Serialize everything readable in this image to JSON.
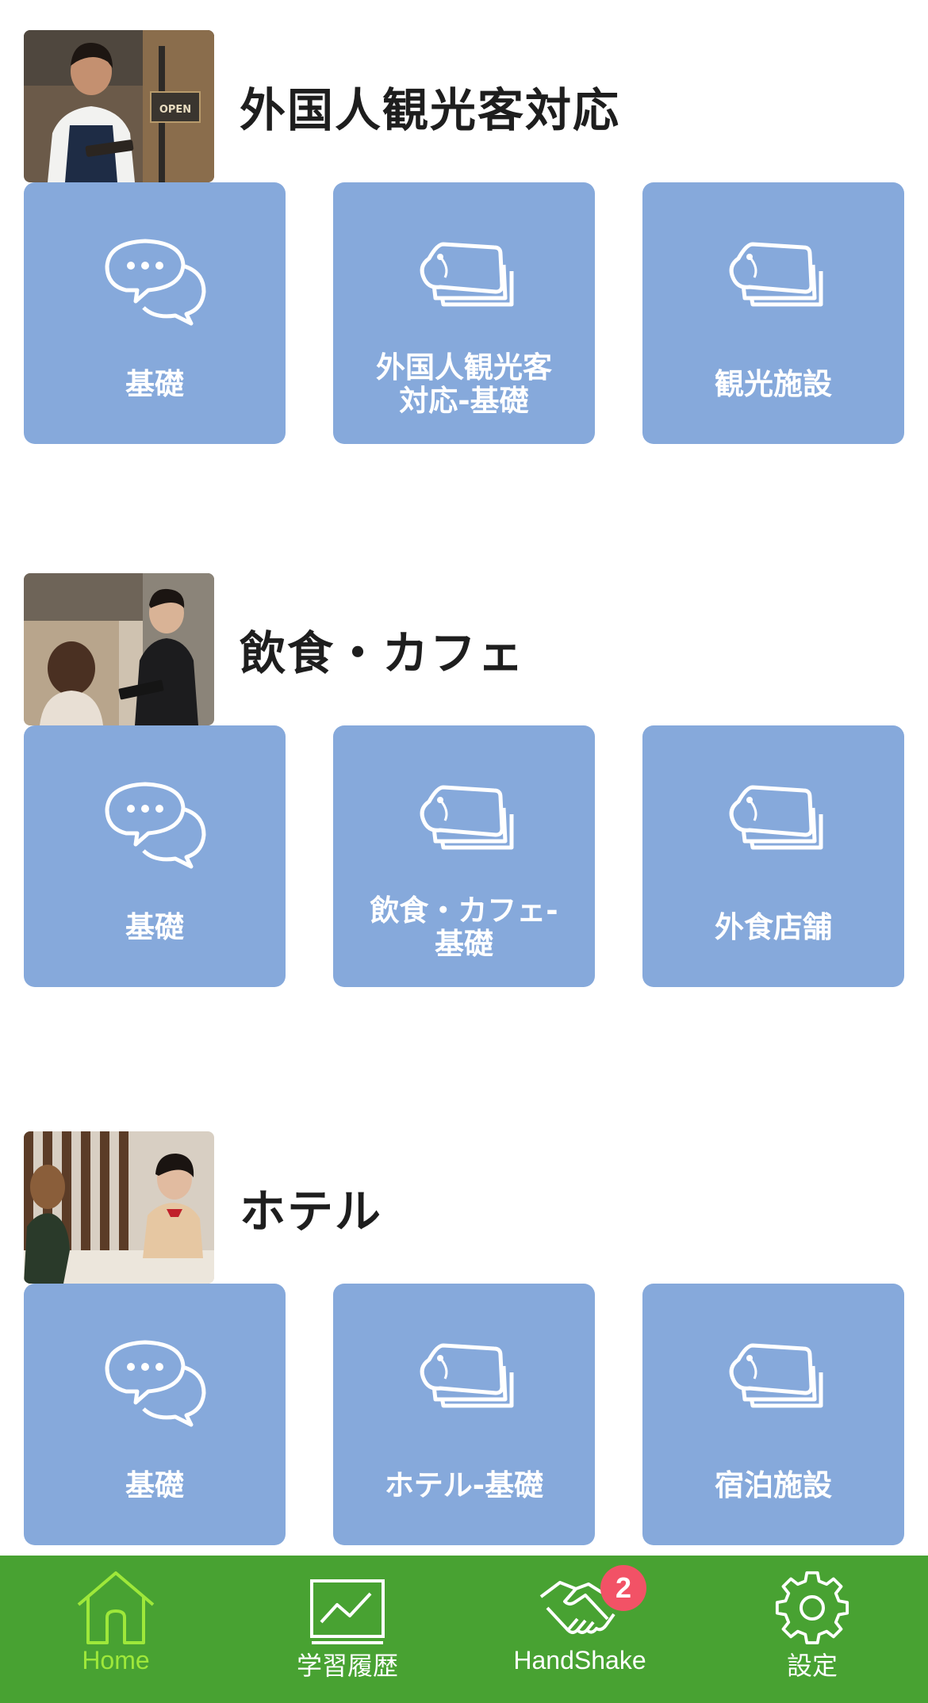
{
  "sections": [
    {
      "title": "外国人観光客対応",
      "cards": [
        {
          "label": "基礎",
          "icon": "chat-bubbles-icon"
        },
        {
          "label": "外国人観光客\n対応-基礎",
          "icon": "flashcards-icon"
        },
        {
          "label": "観光施設",
          "icon": "flashcards-icon"
        }
      ]
    },
    {
      "title": "飲食・カフェ",
      "cards": [
        {
          "label": "基礎",
          "icon": "chat-bubbles-icon"
        },
        {
          "label": "飲食・カフェ-\n基礎",
          "icon": "flashcards-icon"
        },
        {
          "label": "外食店舗",
          "icon": "flashcards-icon"
        }
      ]
    },
    {
      "title": "ホテル",
      "cards": [
        {
          "label": "基礎",
          "icon": "chat-bubbles-icon"
        },
        {
          "label": "ホテル-基礎",
          "icon": "flashcards-icon"
        },
        {
          "label": "宿泊施設",
          "icon": "flashcards-icon"
        }
      ]
    }
  ],
  "photo_sign_text": "OPEN",
  "tabbar": {
    "tabs": [
      {
        "label": "Home",
        "icon": "home-icon",
        "active": true
      },
      {
        "label": "学習履歴",
        "icon": "chart-icon",
        "active": false
      },
      {
        "label": "HandShake",
        "icon": "handshake-icon",
        "active": false,
        "badge": "2"
      },
      {
        "label": "設定",
        "icon": "gear-icon",
        "active": false
      }
    ]
  },
  "colors": {
    "card": "#86a9db",
    "tabbar": "#48a232",
    "active_tab": "#9ee83a",
    "badge": "#f25266"
  }
}
